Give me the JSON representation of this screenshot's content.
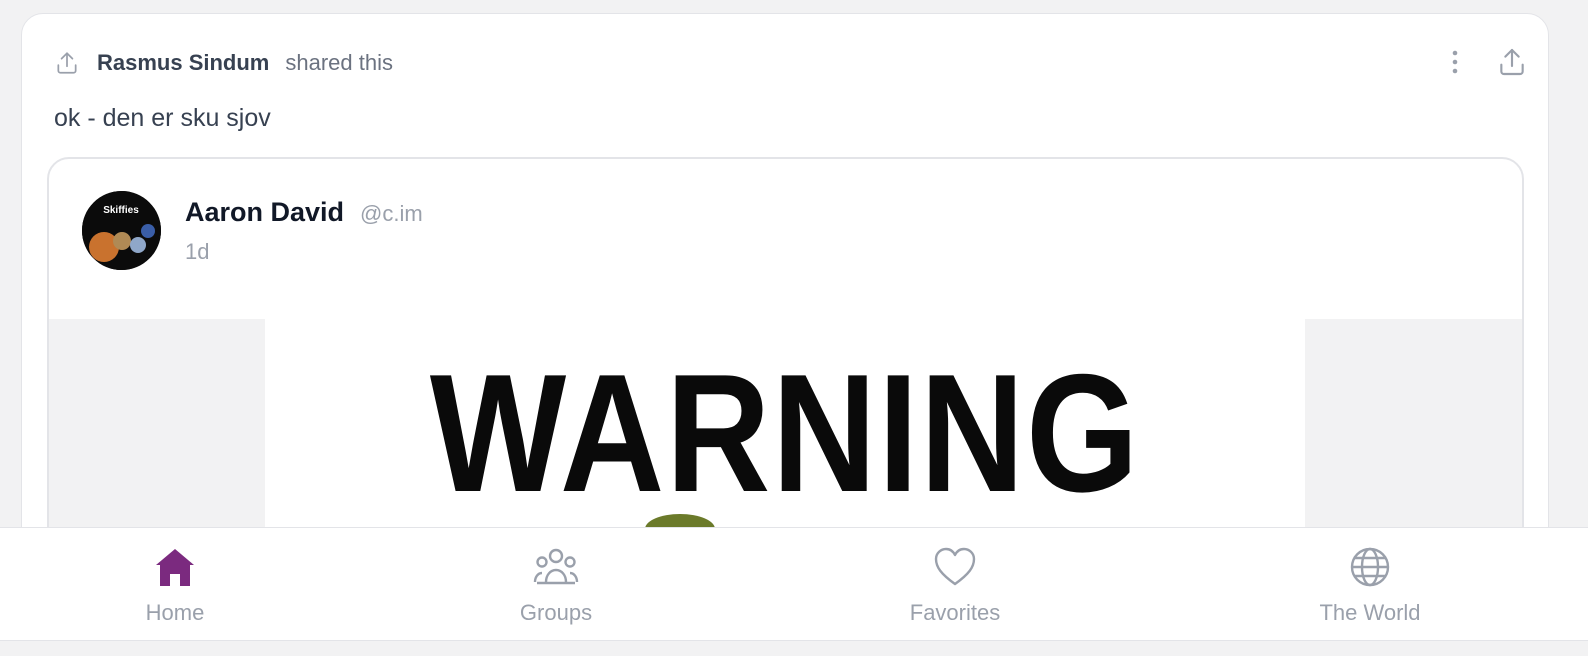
{
  "post": {
    "sharer_name": "Rasmus Sindum",
    "shared_label": "shared this",
    "message": "ok - den er sku sjov",
    "icons": {
      "shared": "upload-icon",
      "more": "more-vertical-icon",
      "share": "share-icon"
    }
  },
  "embedded_post": {
    "avatar_alt": "Skiffies",
    "author_name": "Aaron David",
    "author_handle": "@c.im",
    "time": "1d",
    "image_text": "WARNING"
  },
  "bottom_nav": {
    "items": [
      {
        "label": "Home",
        "icon": "home-icon",
        "active": true
      },
      {
        "label": "Groups",
        "icon": "groups-icon",
        "active": false
      },
      {
        "label": "Favorites",
        "icon": "heart-icon",
        "active": false
      },
      {
        "label": "The World",
        "icon": "globe-icon",
        "active": false
      }
    ]
  },
  "colors": {
    "accent": "#7b2a7f",
    "muted": "#9aa0ab",
    "text": "#374151",
    "border": "#e3e4e8",
    "background": "#f2f2f3"
  }
}
